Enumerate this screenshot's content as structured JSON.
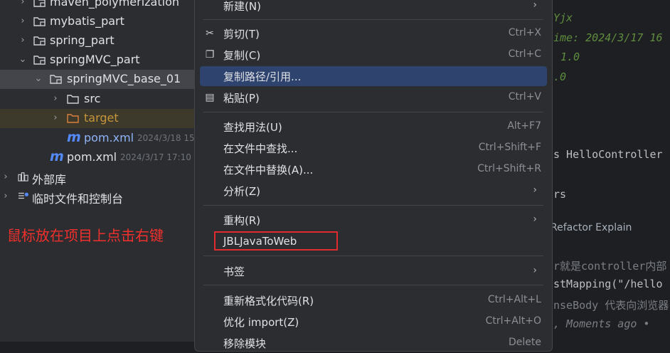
{
  "tree": {
    "items": [
      {
        "label": "maven_polymerization"
      },
      {
        "label": "mybatis_part"
      },
      {
        "label": "spring_part"
      },
      {
        "label": "springMVC_part"
      },
      {
        "label": "springMVC_base_01"
      },
      {
        "label": "src"
      },
      {
        "label": "target"
      },
      {
        "label": "pom.xml",
        "meta": "2024/3/18 15"
      },
      {
        "label": "pom.xml",
        "meta": "2024/3/17 17:10"
      },
      {
        "label": "外部库"
      },
      {
        "label": "临时文件和控制台"
      }
    ],
    "maven_icon": "m"
  },
  "annotation": "鼠标放在项目上点击右键",
  "editor": {
    "lines": [
      "Yjx",
      "ime: 2024/3/17 16",
      "1.0",
      ".0",
      "s HelloController",
      "rs",
      "Refactor  Explain",
      "r就是controller内部",
      "stMapping(\"/hello",
      "nseBody 代表向浏览器",
      ", Moments ago • "
    ]
  },
  "menu": {
    "items": [
      {
        "label": "新建(N)",
        "shortcut": "",
        "icon": ""
      },
      {
        "label": "剪切(T)",
        "shortcut": "Ctrl+X",
        "icon": "scissors-icon"
      },
      {
        "label": "复制(C)",
        "shortcut": "Ctrl+C",
        "icon": "copy-icon"
      },
      {
        "label": "复制路径/引用...",
        "shortcut": "",
        "icon": ""
      },
      {
        "label": "粘贴(P)",
        "shortcut": "Ctrl+V",
        "icon": "paste-icon"
      },
      {
        "label": "查找用法(U)",
        "shortcut": "Alt+F7",
        "icon": ""
      },
      {
        "label": "在文件中查找...",
        "shortcut": "Ctrl+Shift+F",
        "icon": ""
      },
      {
        "label": "在文件中替换(A)...",
        "shortcut": "Ctrl+Shift+R",
        "icon": ""
      },
      {
        "label": "分析(Z)",
        "shortcut": "",
        "icon": ""
      },
      {
        "label": "重构(R)",
        "shortcut": "",
        "icon": ""
      },
      {
        "label": "JBLJavaToWeb",
        "shortcut": "",
        "icon": ""
      },
      {
        "label": "书签",
        "shortcut": "",
        "icon": ""
      },
      {
        "label": "重新格式化代码(R)",
        "shortcut": "Ctrl+Alt+L",
        "icon": ""
      },
      {
        "label": "优化 import(Z)",
        "shortcut": "Ctrl+Alt+O",
        "icon": ""
      },
      {
        "label": "移除模块",
        "shortcut": "Delete",
        "icon": ""
      }
    ]
  },
  "colors": {
    "accent": "#2e436e",
    "annotation": "#f0302d",
    "highlight_box": "#e02c2c",
    "maven": "#548af7"
  }
}
